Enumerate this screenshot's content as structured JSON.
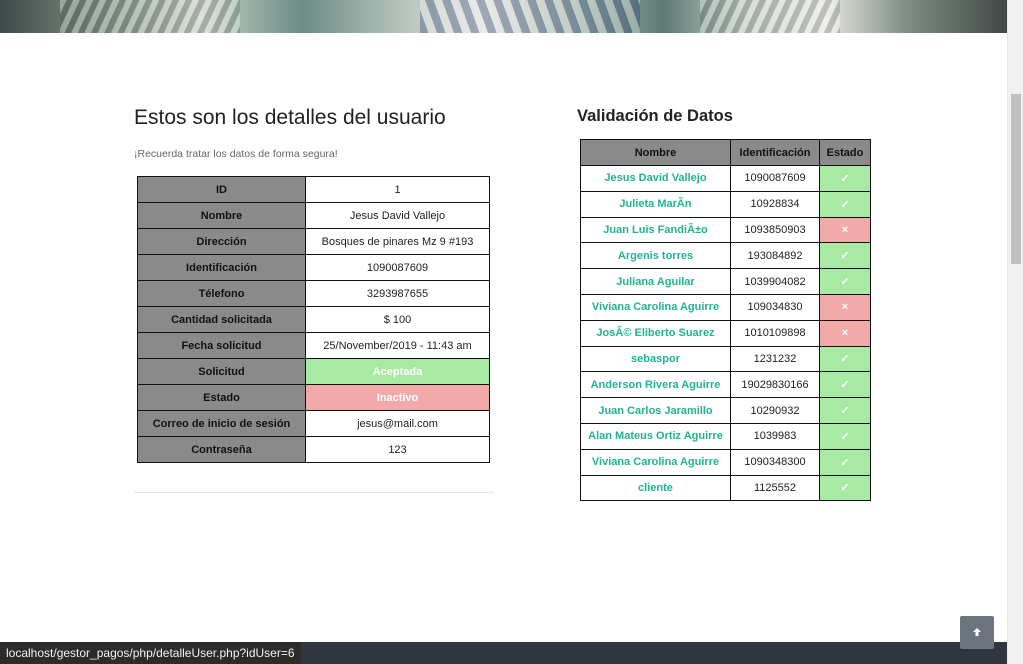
{
  "left": {
    "title": "Estos son los detalles del usuario",
    "subtitle": "¡Recuerda tratar los datos de forma segura!",
    "rows": [
      {
        "key": "ID",
        "value": "1",
        "status": "plain"
      },
      {
        "key": "Nombre",
        "value": "Jesus David Vallejo",
        "status": "plain"
      },
      {
        "key": "Dirección",
        "value": "Bosques de pinares Mz 9 #193",
        "status": "plain"
      },
      {
        "key": "Identificación",
        "value": "1090087609",
        "status": "plain"
      },
      {
        "key": "Télefono",
        "value": "3293987655",
        "status": "plain"
      },
      {
        "key": "Cantidad solicitada",
        "value": "$ 100",
        "status": "plain"
      },
      {
        "key": "Fecha solicitud",
        "value": "25/November/2019 - 11:43 am",
        "status": "plain"
      },
      {
        "key": "Solicitud",
        "value": "Aceptada",
        "status": "ok"
      },
      {
        "key": "Estado",
        "value": "Inactivo",
        "status": "bad"
      },
      {
        "key": "Correo de inicio de sesión",
        "value": "jesus@mail.com",
        "status": "plain"
      },
      {
        "key": "Contraseña",
        "value": "123",
        "status": "plain"
      }
    ]
  },
  "right": {
    "title": "Validación de Datos",
    "headers": [
      "Nombre",
      "Identificación",
      "Estado"
    ],
    "rows": [
      {
        "name": "Jesus David Vallejo",
        "id": "1090087609",
        "ok": true
      },
      {
        "name": "Julieta MarÃn",
        "id": "10928834",
        "ok": true
      },
      {
        "name": "Juan Luis FandiÃ±o",
        "id": "1093850903",
        "ok": false
      },
      {
        "name": "Argenis torres",
        "id": "193084892",
        "ok": true
      },
      {
        "name": "Juliana Aguilar",
        "id": "1039904082",
        "ok": true
      },
      {
        "name": "Viviana Carolina Aguirre",
        "id": "109034830",
        "ok": false
      },
      {
        "name": "JosÃ© Eliberto Suarez",
        "id": "1010109898",
        "ok": false
      },
      {
        "name": "sebaspor",
        "id": "1231232",
        "ok": true
      },
      {
        "name": "Anderson Rivera Aguirre",
        "id": "19029830166",
        "ok": true
      },
      {
        "name": "Juan Carlos Jaramillo",
        "id": "10290932",
        "ok": true
      },
      {
        "name": "Alan Mateus Ortiz Aguirre",
        "id": "1039983",
        "ok": true
      },
      {
        "name": "Viviana Carolina Aguirre",
        "id": "1090348300",
        "ok": true
      },
      {
        "name": "cliente",
        "id": "1125552",
        "ok": true
      }
    ],
    "ok_symbol": "✓",
    "bad_symbol": "×"
  },
  "status_url": "localhost/gestor_pagos/php/detalleUser.php?idUser=6",
  "back_to_top_icon": "arrow-up-icon",
  "colors": {
    "ok": "#a8e9a3",
    "bad": "#f1a9a9",
    "header_gray": "#8a8a8a",
    "name_teal": "#1fb590"
  }
}
